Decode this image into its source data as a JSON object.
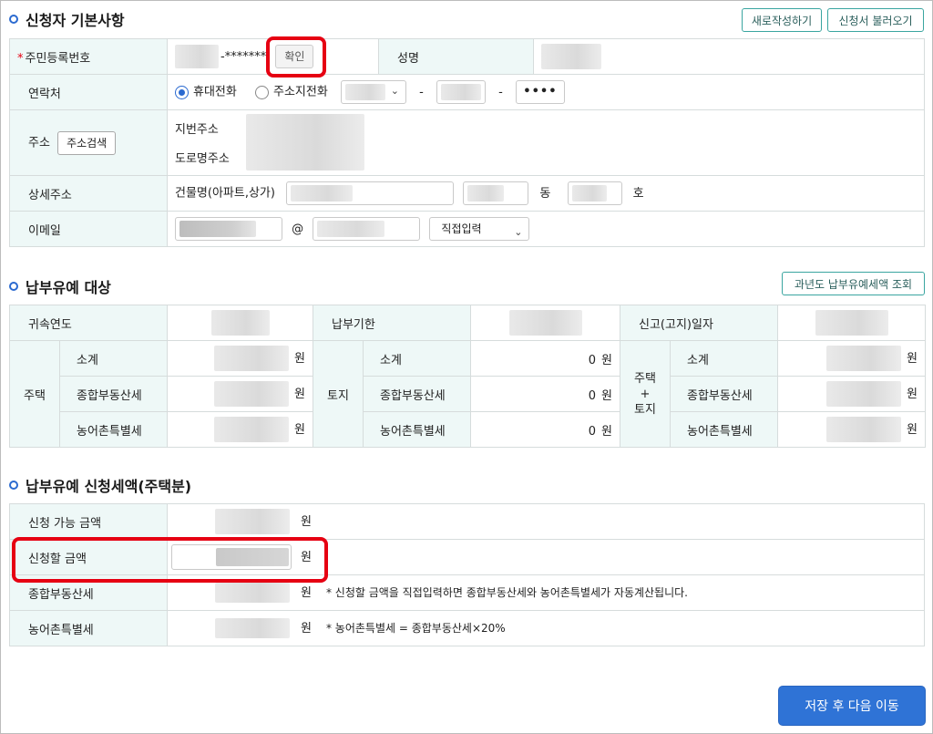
{
  "applicant": {
    "title": "신청자 기본사항",
    "new_button": "새로작성하기",
    "load_button": "신청서 불러오기",
    "rrn_label": "주민등록번호",
    "rrn_mask": "-*******",
    "confirm_button": "확인",
    "name_label": "성명",
    "contact_label": "연락처",
    "radio_mobile": "휴대전화",
    "radio_home": "주소지전화",
    "dash1": "-",
    "dash2": "-",
    "phone_last": "••••",
    "address_label": "주소",
    "address_search_button": "주소검색",
    "jibun_label": "지번주소",
    "road_label": "도로명주소",
    "detail_label": "상세주소",
    "building_label": "건물명(아파트,상가)",
    "dong_label": "동",
    "ho_label": "호",
    "email_label": "이메일",
    "at_sign": "@",
    "email_domain_select": "직접입력"
  },
  "deferral": {
    "title": "납부유예 대상",
    "lookup_button": "과년도 납부유예세액 조회",
    "year_label": "귀속연도",
    "due_label": "납부기한",
    "report_label": "신고(고지)일자",
    "housing_label": "주택",
    "land_label": "토지",
    "combined_label_1": "주택",
    "combined_label_2": "+",
    "combined_label_3": "토지",
    "subtotal": "소계",
    "comprehensive": "종합부동산세",
    "rural": "농어촌특별세",
    "won": "원",
    "land_values": [
      "0",
      "0",
      "0"
    ]
  },
  "request": {
    "title": "납부유예 신청세액(주택분)",
    "available_label": "신청 가능 금액",
    "amount_label": "신청할 금액",
    "comprehensive_label": "종합부동산세",
    "rural_label": "농어촌특별세",
    "won": "원",
    "note1": "* 신청할 금액을 직접입력하면 종합부동산세와 농어촌특별세가 자동계산됩니다.",
    "note2": "* 농어촌특별세 = 종합부동산세×20%"
  },
  "save_button": "저장 후 다음 이동"
}
